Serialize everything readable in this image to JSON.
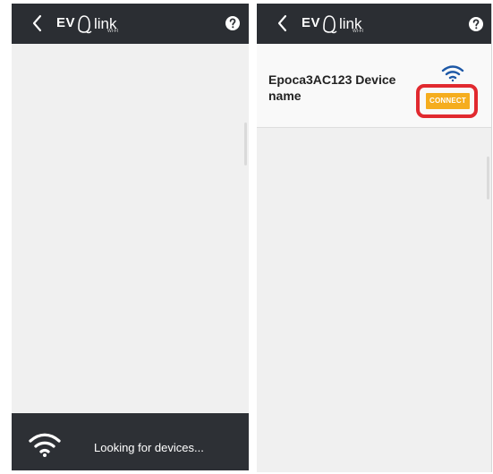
{
  "colors": {
    "appbar": "#2b2e33",
    "screen_background": "#f0f0f0",
    "device_card_background": "#f9f9f9",
    "connect_button": "#f5ad1e",
    "highlight": "#e1292f",
    "signal_icon": "#1d58a6",
    "text": "#222222",
    "white": "#ffffff"
  },
  "left_screen": {
    "appbar": {
      "logo_prefix": "EV",
      "logo_name": "link",
      "logo_subtext": "WI-FI",
      "back_icon": "chevron-left-icon",
      "help_icon": "question-circle-icon"
    },
    "status": {
      "icon": "wifi-icon",
      "text": "Looking for devices..."
    }
  },
  "right_screen": {
    "appbar": {
      "logo_prefix": "EV",
      "logo_name": "link",
      "logo_subtext": "WI-FI",
      "back_icon": "chevron-left-icon",
      "help_icon": "question-circle-icon"
    },
    "device": {
      "name": "Epoca3AC123 Device name",
      "signal_icon": "wifi-signal-icon",
      "connect_label": "CONNECT"
    }
  }
}
